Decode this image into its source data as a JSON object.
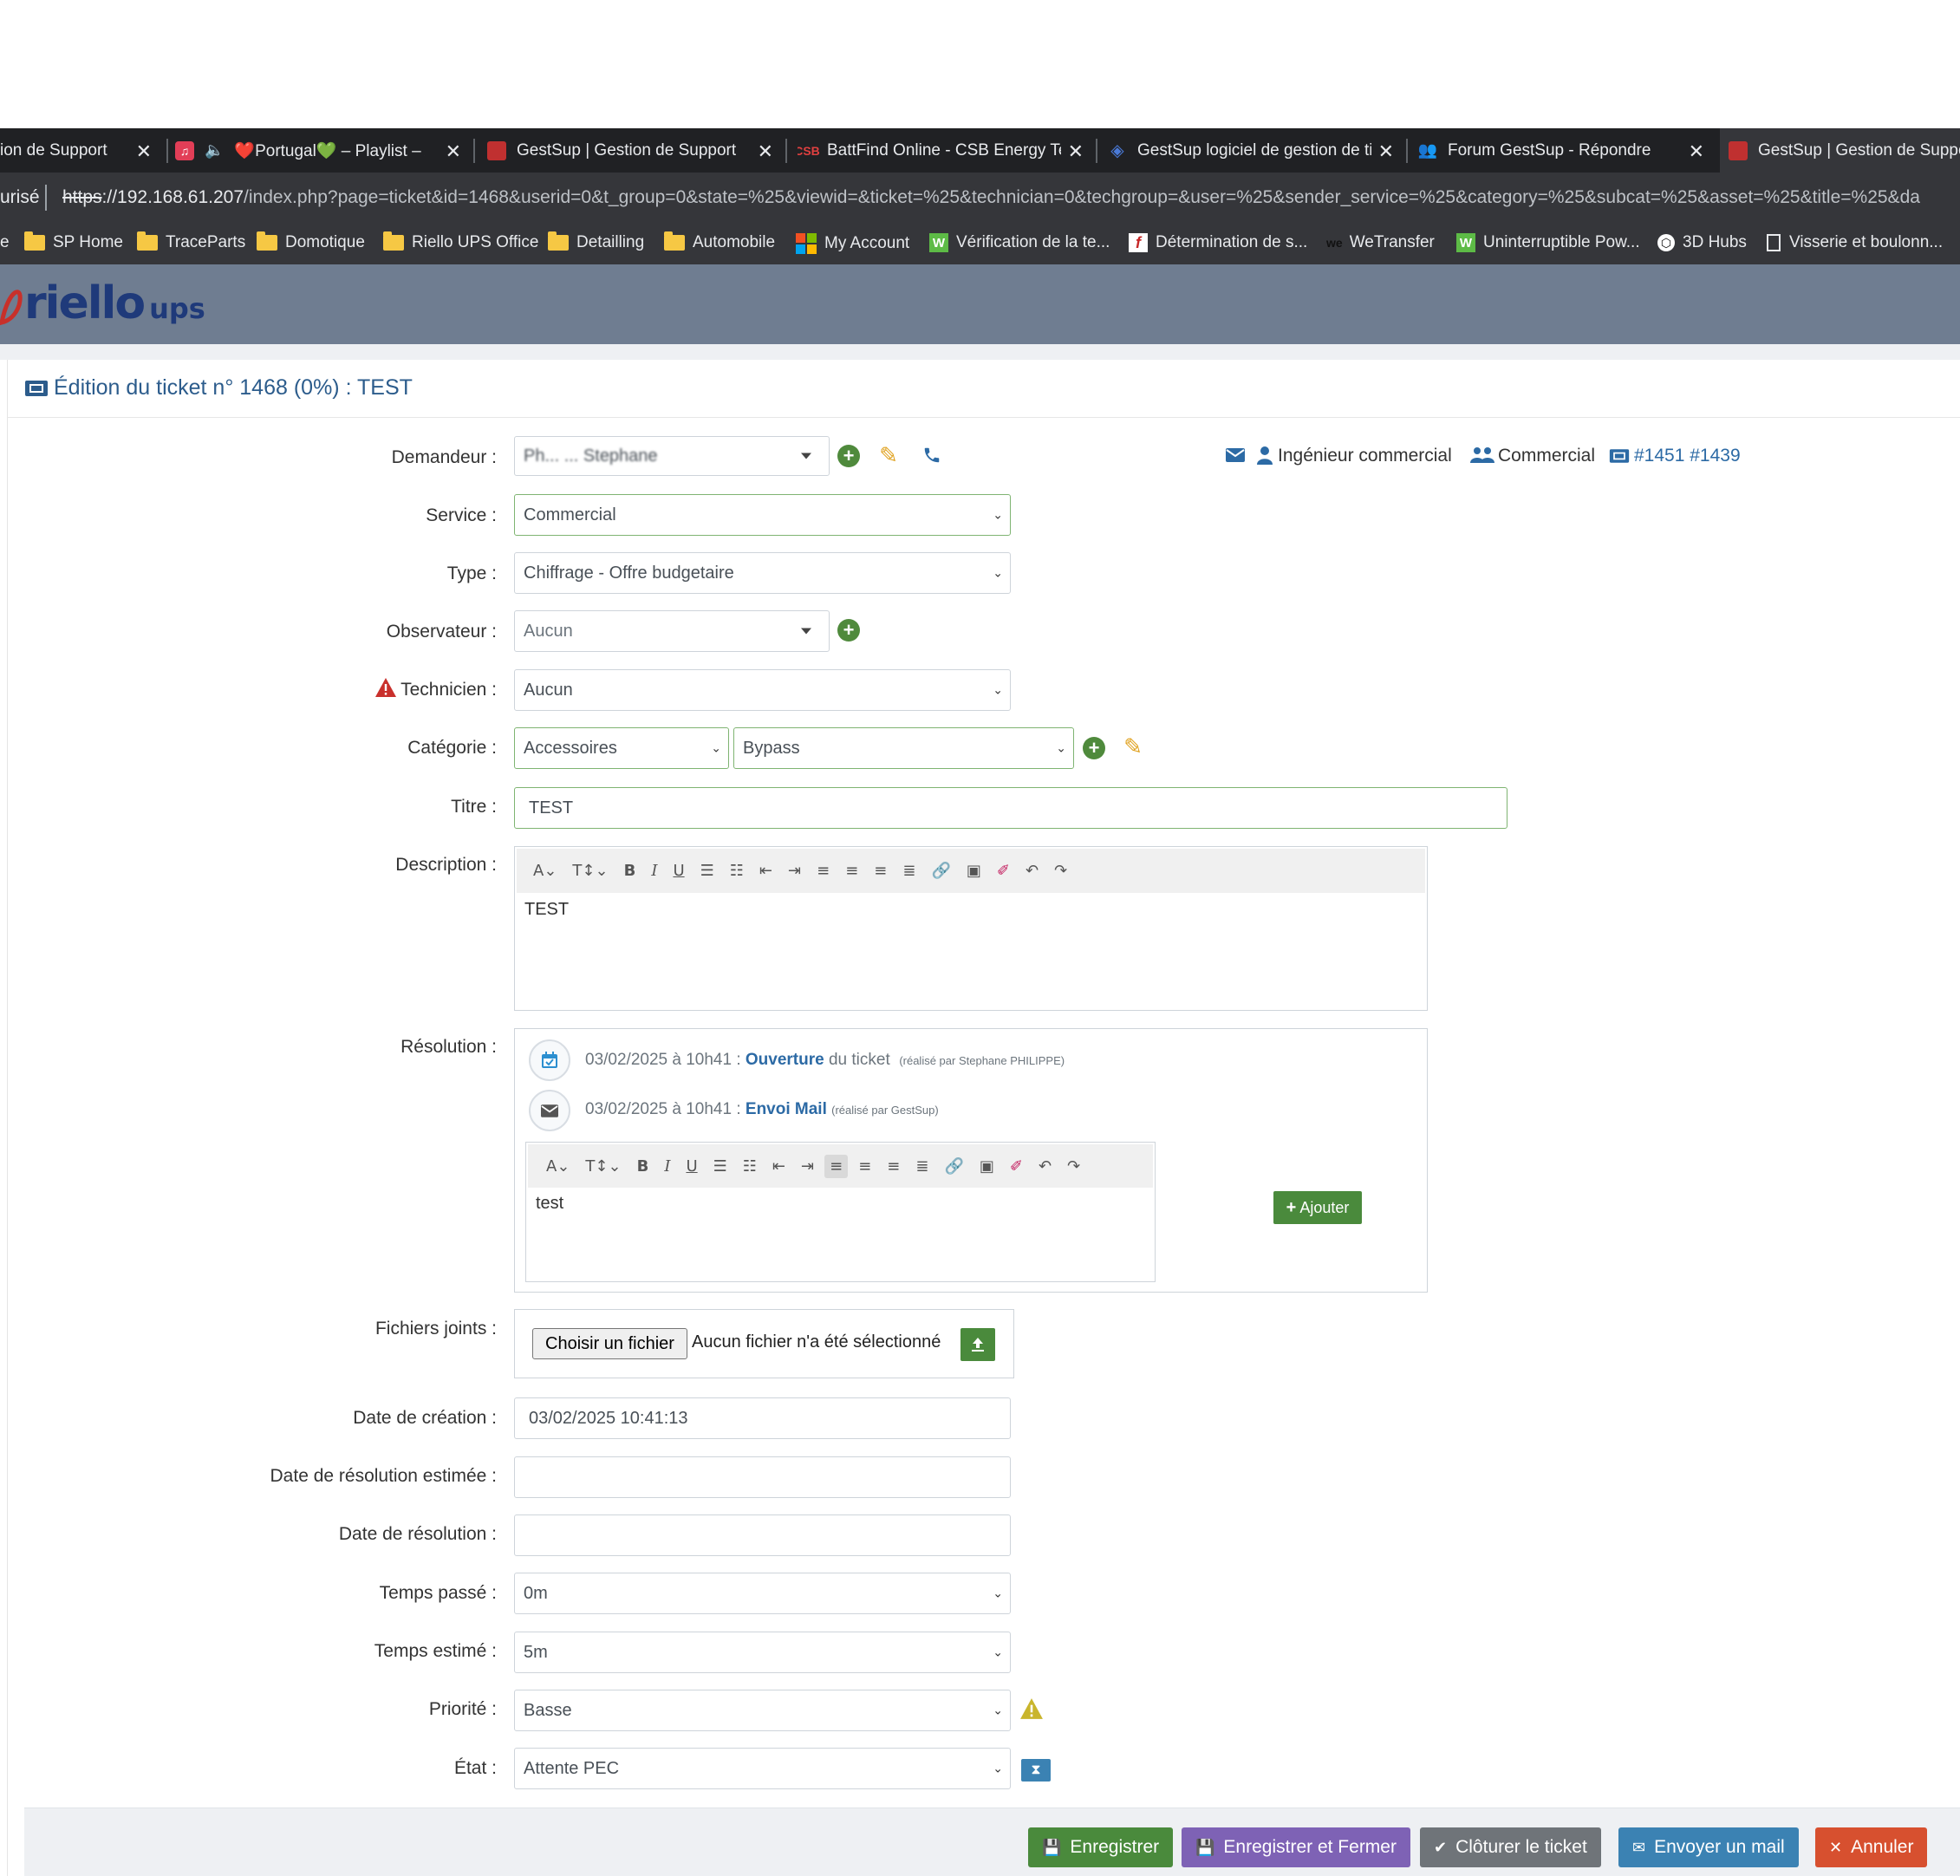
{
  "browser": {
    "tabs": [
      {
        "title": "ion de Support",
        "active": false
      },
      {
        "title": "❤️Portugal💚 – Playlist – Ap",
        "active": false
      },
      {
        "title": "GestSup | Gestion de Support",
        "active": false
      },
      {
        "title": "BattFind Online - CSB Energy Tech",
        "active": false
      },
      {
        "title": "GestSup logiciel de gestion de tick",
        "active": false
      },
      {
        "title": "Forum GestSup - Répondre",
        "active": false
      },
      {
        "title": "GestSup | Gestion de Suppor",
        "active": true
      }
    ],
    "url_prefix": "urisé",
    "url_scheme": "https",
    "url_host": "://192.168.61.207",
    "url_path": "/index.php?page=ticket&id=1468&userid=0&t_group=0&state=%25&viewid=&ticket=%25&technician=0&techgroup=&user=%25&sender_service=%25&category=%25&subcat=%25&asset=%25&title=%25&da",
    "bookmarks": [
      "SP Home",
      "TraceParts",
      "Domotique",
      "Riello UPS Office",
      "Detailling",
      "Automobile",
      "My Account",
      "Vérification de la te...",
      "Détermination de s...",
      "WeTransfer",
      "Uninterruptible Pow...",
      "3D Hubs",
      "Visserie et boulonn..."
    ]
  },
  "app": {
    "logo_main": "riello",
    "logo_sub": "ups",
    "page_title": "Édition du ticket n° 1468 (0%) : TEST"
  },
  "form": {
    "demandeur_label": "Demandeur :",
    "demandeur_value": "Ph... ... Stephane",
    "service_label": "Service :",
    "service_value": "Commercial",
    "type_label": "Type :",
    "type_value": "Chiffrage - Offre budgetaire",
    "observateur_label": "Observateur :",
    "observateur_value": "Aucun",
    "technicien_label": "Technicien :",
    "technicien_value": "Aucun",
    "categorie_label": "Catégorie :",
    "categorie_value": "Accessoires",
    "subcat_value": "Bypass",
    "titre_label": "Titre :",
    "titre_value": "TEST",
    "description_label": "Description :",
    "description_text": "TEST",
    "resolution_label": "Résolution :",
    "fichiers_label": "Fichiers joints :",
    "file_button": "Choisir un fichier",
    "file_status": "Aucun fichier n'a été sélectionné",
    "date_creation_label": "Date de création :",
    "date_creation_value": "03/02/2025 10:41:13",
    "date_res_est_label": "Date de résolution estimée :",
    "date_res_est_value": "",
    "date_res_label": "Date de résolution :",
    "date_res_value": "",
    "temps_passe_label": "Temps passé :",
    "temps_passe_value": "0m",
    "temps_estime_label": "Temps estimé :",
    "temps_estime_value": "5m",
    "priorite_label": "Priorité :",
    "priorite_value": "Basse",
    "etat_label": "État :",
    "etat_value": "Attente PEC"
  },
  "requester_info": {
    "role": "Ingénieur commercial",
    "group": "Commercial",
    "tickets": "#1451 #1439"
  },
  "resolution": {
    "event1_date": "03/02/2025 à 10h41 :",
    "event1_action": "Ouverture",
    "event1_suffix": "du ticket",
    "event1_by": "(réalisé par Stephane PHILIPPE)",
    "event2_date": "03/02/2025 à 10h41 :",
    "event2_action": "Envoi Mail",
    "event2_by": "(réalisé par GestSup)",
    "editor_text": "test",
    "add_button": "Ajouter"
  },
  "actions": {
    "save": "Enregistrer",
    "save_close": "Enregistrer et Fermer",
    "close_ticket": "Clôturer le ticket",
    "send_mail": "Envoyer un mail",
    "cancel": "Annuler"
  },
  "colors": {
    "save": "#4a8a3c",
    "save_close": "#7e62b5",
    "close_ticket": "#6f7479",
    "send_mail": "#3b82b3",
    "cancel": "#d7502f",
    "header": "#6f7d91",
    "link": "#2c6aa5"
  }
}
